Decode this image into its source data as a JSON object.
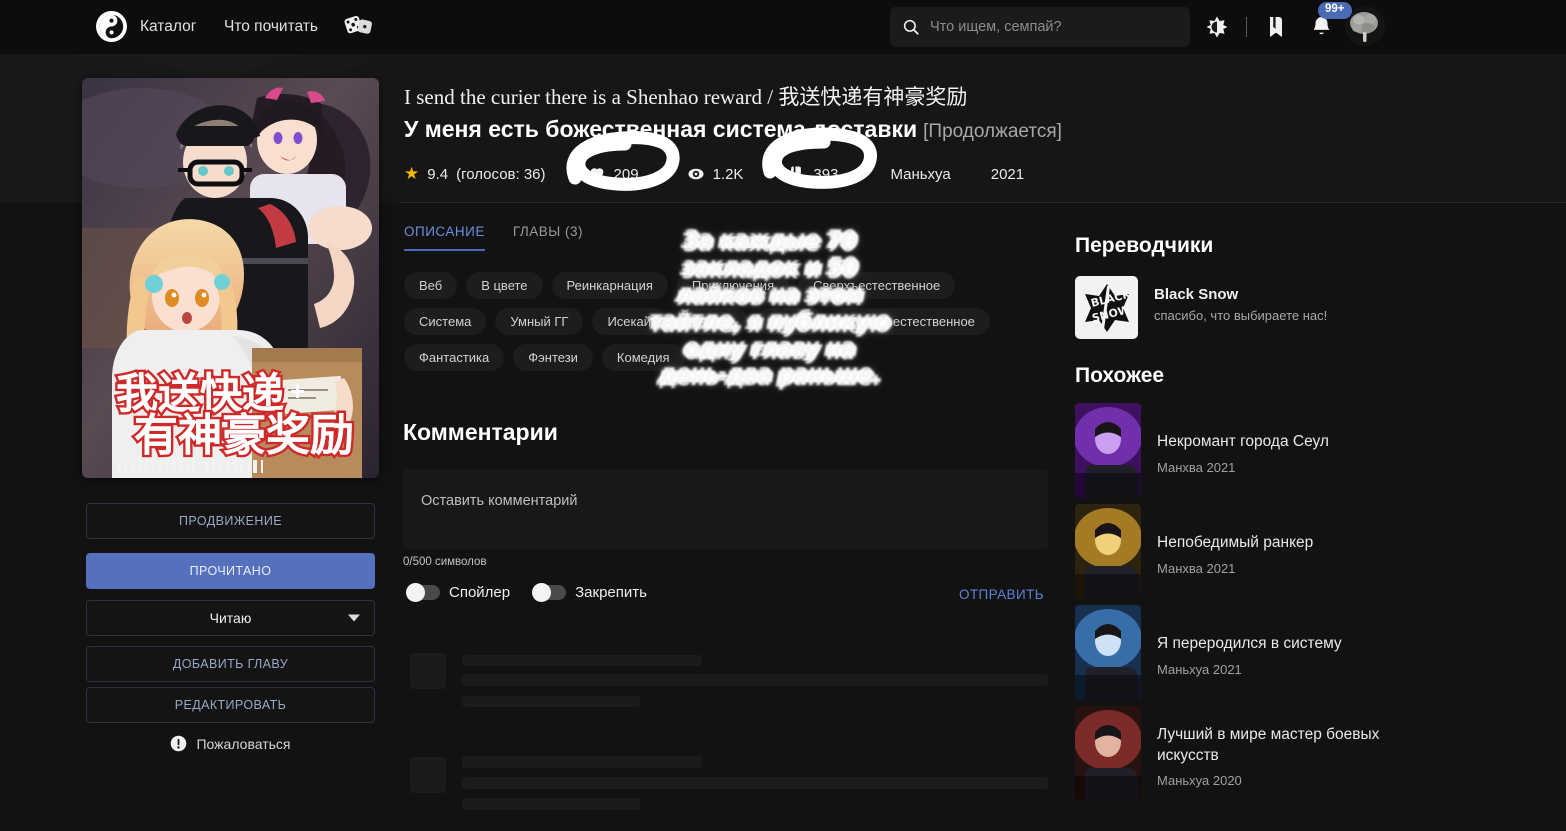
{
  "header": {
    "logo_icon": "yin-yang-logo",
    "nav": [
      {
        "label": "Каталог",
        "name": "nav-catalog"
      },
      {
        "label": "Что почитать",
        "name": "nav-what-to-read"
      }
    ],
    "dice_icon": "dice-icon",
    "search": {
      "placeholder": "Что ищем, семпай?",
      "value": "",
      "icon": "search-icon"
    },
    "theme_icon": "contrast-theme-icon",
    "bookmarks_icon": "bookmark-icon",
    "notifications_icon": "bell-icon",
    "notifications_badge": "99+",
    "avatar_icon": "user-avatar"
  },
  "title": {
    "original": "I send the curier there is a Shenhao reward / 我送快递有神豪奖励",
    "russian": "У меня есть божественная система доставки",
    "status": "[Продолжается]"
  },
  "meta": {
    "rating_value": "9.4",
    "rating_votes": "(голосов: 36)",
    "likes": "209",
    "views": "1.2K",
    "bookmarks": "393",
    "type": "Маньхуа",
    "year": "2021",
    "star_icon": "star-icon",
    "heart_icon": "heart-icon",
    "eye_icon": "eye-icon",
    "bookmark_icon": "bookmark-icon"
  },
  "tabs": [
    {
      "label": "ОПИСАНИЕ",
      "active": true
    },
    {
      "label": "ГЛАВЫ (3)",
      "active": false
    }
  ],
  "tags": [
    "Веб",
    "В цвете",
    "Реинкарнация",
    "Приключения",
    "Сверхъестественное",
    "Система",
    "Умный ГГ",
    "Исекай",
    "Боевик",
    "Гарем",
    "Сверхъестественное",
    "Фантастика",
    "Фэнтези",
    "Комедия"
  ],
  "sidebar_buttons": {
    "promote": "ПРОДВИЖЕНИЕ",
    "read": "ПРОЧИТАНО",
    "status_select": "Читаю",
    "add_chapter": "ДОБАВИТЬ ГЛАВУ",
    "edit": "РЕДАКТИРОВАТЬ",
    "report": "Пожаловаться",
    "report_icon": "warning-icon"
  },
  "comments": {
    "heading": "Комментарии",
    "input_placeholder": "Оставить комментарий",
    "input_value": "",
    "char_count": "0/500 символов",
    "spoiler_label": "Спойлер",
    "pin_label": "Закрепить",
    "submit_label": "ОТПРАВИТЬ"
  },
  "right_sidebar": {
    "translators_heading": "Переводчики",
    "translator": {
      "name": "Black Snow",
      "tagline": "спасибо, что выбираете нас!",
      "logo_icon": "black-snow-logo"
    },
    "similar_heading": "Похожее",
    "similar": [
      {
        "name": "Некромант города Сеул",
        "meta": "Манхва 2021"
      },
      {
        "name": "Непобедимый ранкер",
        "meta": "Манхва 2021"
      },
      {
        "name": "Я переродился в систему",
        "meta": "Маньхуа 2021"
      },
      {
        "name": "Лучший в мире мастер боевых искусств",
        "meta": "Маньхуа 2020"
      }
    ]
  },
  "annotation": {
    "text": "За каждые 70 закладок и 50 лайков на этом тайтле, я публикую одну главу на день-два раньше."
  },
  "colors": {
    "accent": "#5571bd",
    "link": "#5d83d9",
    "page_bg": "#121212",
    "header_bg": "#0d0d0d",
    "banner_bg": "#161616",
    "star": "#f2b705"
  }
}
